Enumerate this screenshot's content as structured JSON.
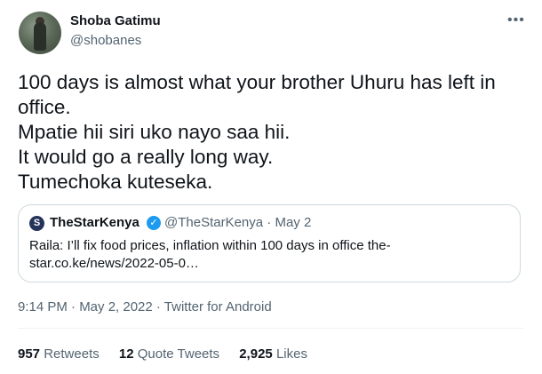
{
  "author": {
    "name": "Shoba Gatimu",
    "handle": "@shobanes"
  },
  "more_icon": "more-dots-icon",
  "tweet": {
    "lines": [
      "100 days is almost what your brother Uhuru has left in",
      "office.",
      "Mpatie hii siri uko nayo saa hii.",
      "It would go a really long way.",
      "Tumechoka kuteseka."
    ]
  },
  "quote": {
    "logo_letter": "S",
    "name": "TheStarKenya",
    "verified_icon": "verified-badge-icon",
    "handle_date": "@TheStarKenya · May 2",
    "text_lines": [
      "Raila: I’ll fix food prices, inflation within 100 days in office  the-",
      "star.co.ke/news/2022-05-0…"
    ]
  },
  "meta": "9:14 PM · May 2, 2022 · Twitter for Android",
  "stats": {
    "retweets": {
      "count": "957",
      "label": "Retweets"
    },
    "quote_tweets": {
      "count": "12",
      "label": "Quote Tweets"
    },
    "likes": {
      "count": "2,925",
      "label": "Likes"
    }
  },
  "colors": {
    "text": "#0f1419",
    "secondary": "#536471",
    "border": "#cfd9de",
    "verified": "#1d9bf0"
  }
}
